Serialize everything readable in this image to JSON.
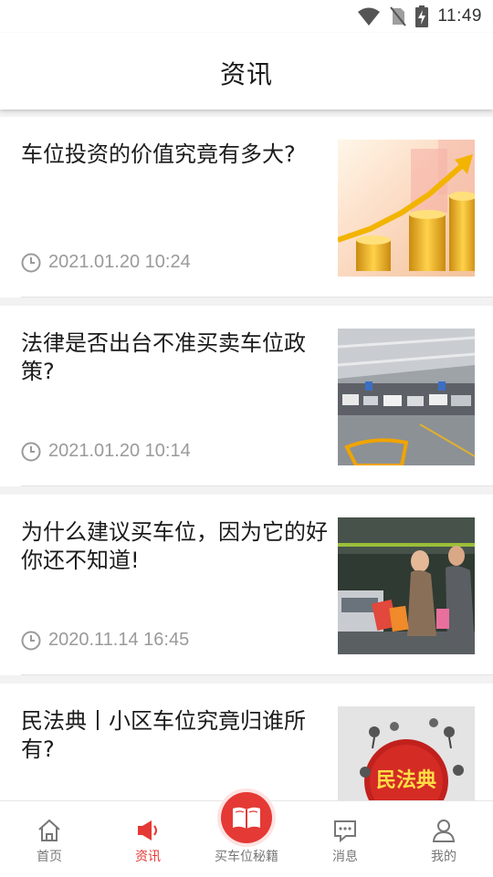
{
  "status_bar": {
    "time": "11:49"
  },
  "header": {
    "title": "资讯"
  },
  "news": [
    {
      "title": "车位投资的价值究竟有多大?",
      "time": "2021.01.20 10:24",
      "image": "coins-growth-photo"
    },
    {
      "title": "法律是否出台不准买卖车位政策?",
      "time": "2021.01.20 10:14",
      "image": "parking-garage-photo"
    },
    {
      "title": "为什么建议买车位，因为它的好你还不知道!",
      "time": "2020.11.14 16:45",
      "image": "couple-shopping-photo"
    },
    {
      "title": "民法典丨小区车位究竟归谁所有?",
      "time": "",
      "image": "civil-code-photo",
      "image_text": "民法典"
    }
  ],
  "bottom_nav": {
    "items": [
      {
        "label": "首页",
        "icon": "home-icon"
      },
      {
        "label": "资讯",
        "icon": "megaphone-icon",
        "active": true
      },
      {
        "label": "买车位秘籍",
        "icon": "book-icon"
      },
      {
        "label": "消息",
        "icon": "message-icon"
      },
      {
        "label": "我的",
        "icon": "user-icon"
      }
    ]
  },
  "colors": {
    "accent": "#e53935",
    "text": "#1c1c1c",
    "meta": "#9a9a9a",
    "background": "#f2f2f2"
  }
}
